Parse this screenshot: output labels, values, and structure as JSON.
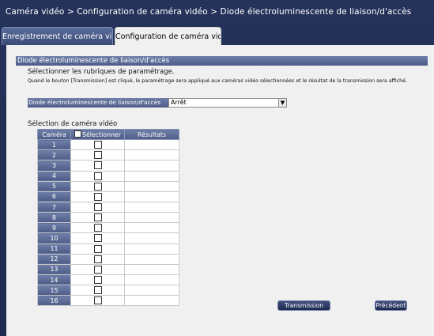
{
  "window": {
    "breadcrumb": "Caméra vidéo > Configuration de caméra vidéo > Diode électroluminescente de liaison/d'accès"
  },
  "tabs": [
    {
      "label": "Enregistrement de caméra vidéo",
      "active": false
    },
    {
      "label": "Configuration de caméra vidéo",
      "active": true
    }
  ],
  "section": {
    "title": "Diode électroluminescente de liaison/d'accès",
    "subheading": "Sélectionner les rubriques de paramétrage.",
    "note": "Quand le bouton [Transmission] est cliqué, le paramétrage sera appliqué aux caméras vidéo sélectionnées et le résultat de la transmission sera affiché."
  },
  "led_setting": {
    "label": "Diode électroluminescente de liaison/d'accès",
    "value": "Arrêt",
    "arrow_icon": "▼"
  },
  "camera_selection": {
    "title": "Sélection de caméra vidéo",
    "headers": {
      "camera": "Caméra",
      "select": "Sélectionner",
      "results": "Résultats"
    },
    "cameras": [
      {
        "num": "1",
        "selected": false,
        "result": ""
      },
      {
        "num": "2",
        "selected": false,
        "result": ""
      },
      {
        "num": "3",
        "selected": false,
        "result": ""
      },
      {
        "num": "4",
        "selected": false,
        "result": ""
      },
      {
        "num": "5",
        "selected": false,
        "result": ""
      },
      {
        "num": "6",
        "selected": false,
        "result": ""
      },
      {
        "num": "7",
        "selected": false,
        "result": ""
      },
      {
        "num": "8",
        "selected": false,
        "result": ""
      },
      {
        "num": "9",
        "selected": false,
        "result": ""
      },
      {
        "num": "10",
        "selected": false,
        "result": ""
      },
      {
        "num": "11",
        "selected": false,
        "result": ""
      },
      {
        "num": "12",
        "selected": false,
        "result": ""
      },
      {
        "num": "13",
        "selected": false,
        "result": ""
      },
      {
        "num": "14",
        "selected": false,
        "result": ""
      },
      {
        "num": "15",
        "selected": false,
        "result": ""
      },
      {
        "num": "16",
        "selected": false,
        "result": ""
      }
    ]
  },
  "buttons": {
    "transmission": "Transmission",
    "previous": "Précédent"
  },
  "colors": {
    "background": "#1f2b4e",
    "panel": "#f0f0f0",
    "header_bar": "#5a6a94"
  }
}
